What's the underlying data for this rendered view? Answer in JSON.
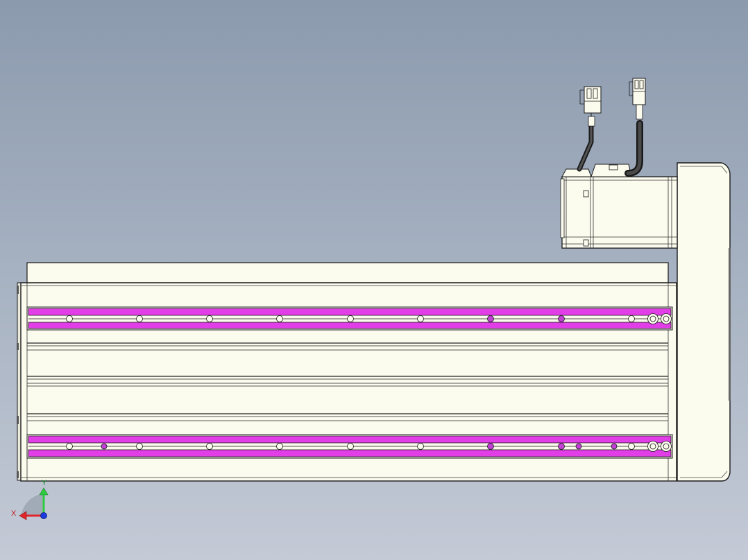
{
  "view": {
    "background_top": "#8c9aae",
    "background_bottom": "#c4cad6",
    "part_color": "#fbfbee",
    "rail_color": "#e23ee8",
    "outline_color": "#1a1a1a"
  },
  "axis_triad": {
    "x_label": "X",
    "y_label": "Y",
    "x_color": "#e0262b",
    "y_color": "#2ecc40",
    "z_color": "#1a3ae0"
  },
  "components": [
    "linear-module-body",
    "top-rail",
    "bottom-rail",
    "end-plate",
    "servo-motor",
    "power-connector",
    "encoder-connector"
  ]
}
